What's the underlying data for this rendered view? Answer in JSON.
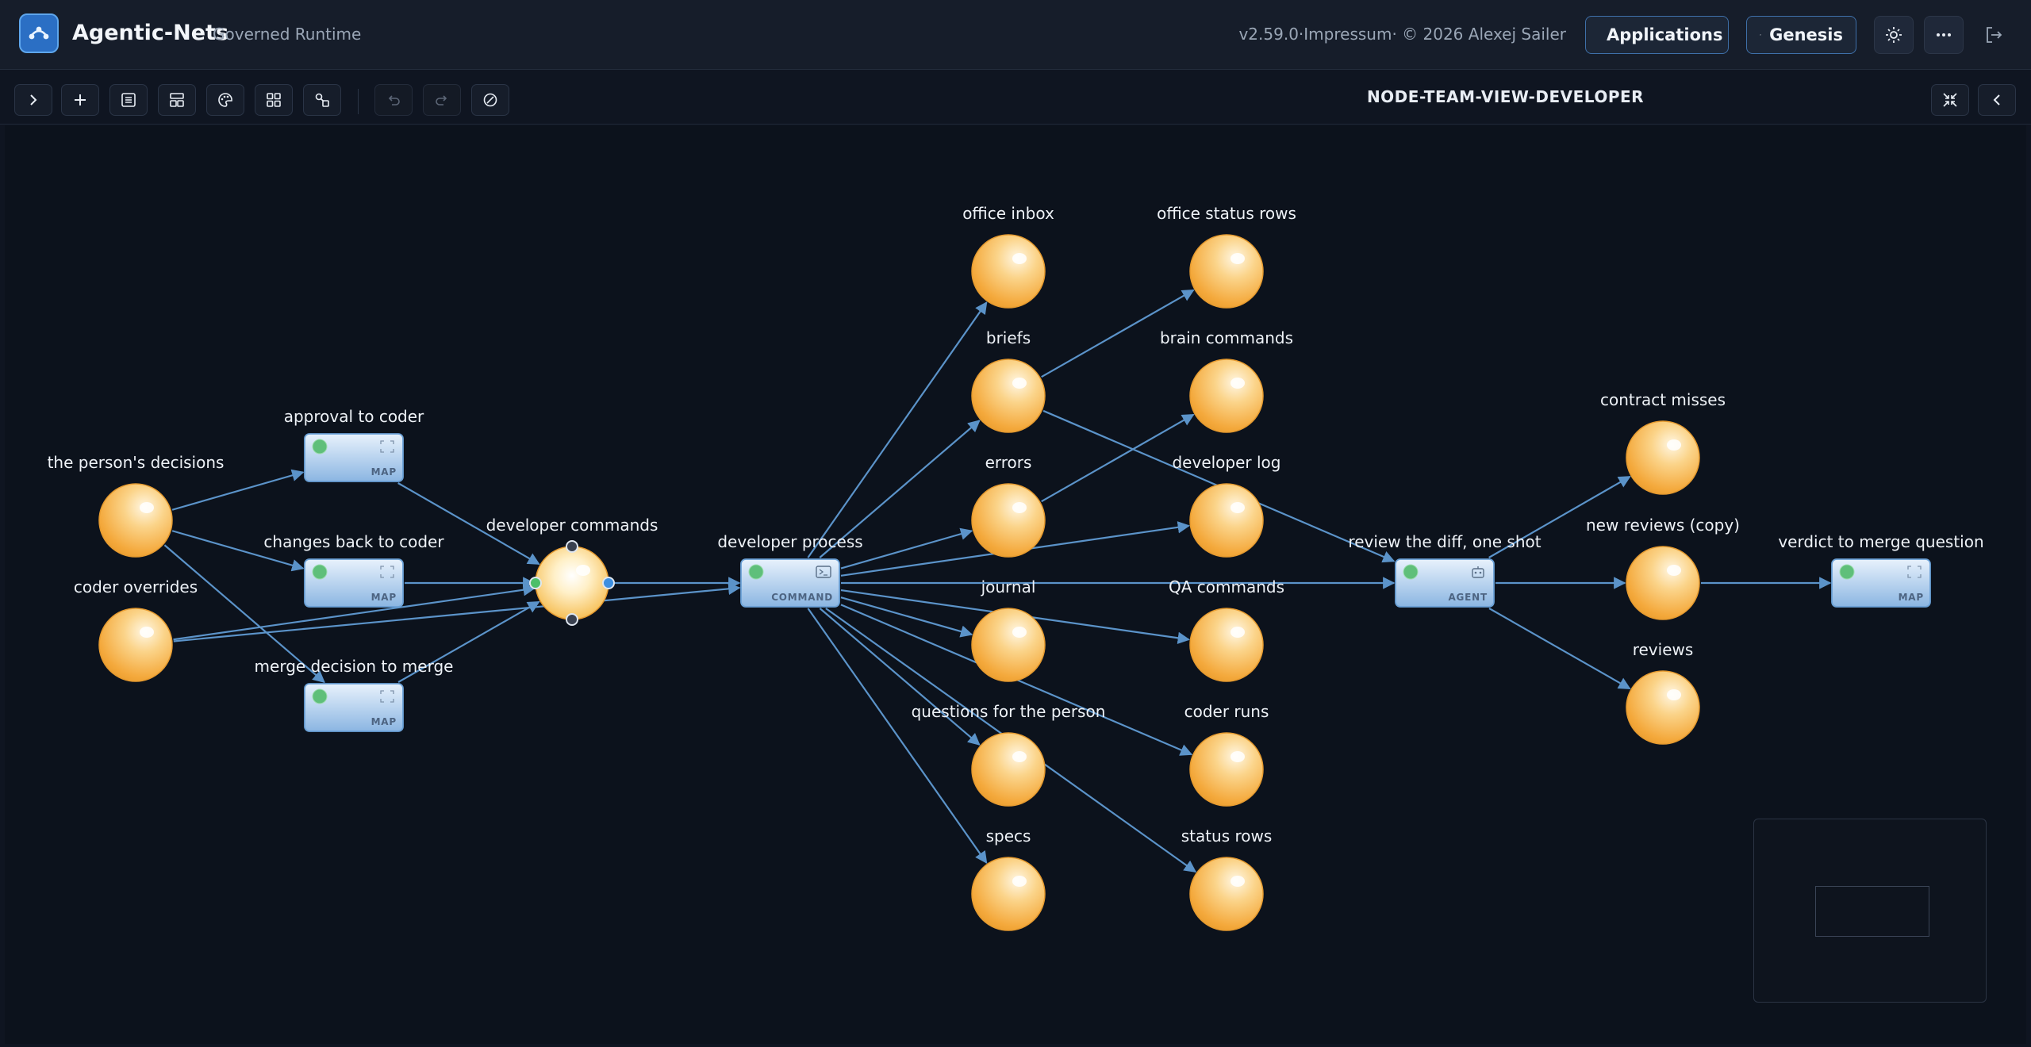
{
  "header": {
    "app_title": "Agentic-Nets",
    "app_subtitle": "Governed Runtime",
    "version": "v2.59.0·Impressum· © 2026 Alexej Sailer",
    "applications_label": "Applications",
    "genesis_label": "Genesis",
    "icons": [
      "network-logo-icon",
      "applications-icon",
      "genesis-sparkle-icon",
      "theme-sun-icon",
      "more-icon",
      "logout-icon"
    ]
  },
  "toolbar": {
    "icons": [
      "expand-chevron-icon",
      "add-icon",
      "list-icon",
      "layout-icon",
      "palette-icon",
      "grid-icon",
      "connect-icon",
      "undo-icon",
      "redo-icon",
      "validate-icon",
      "fullscreen-collapse-icon",
      "panel-collapse-icon"
    ],
    "net_title": "NODE-TEAM-VIEW-DEVELOPER"
  },
  "colors": {
    "accent": "#3e6fa8",
    "arc": "#5b93c9",
    "place": "#f7b84c",
    "transition": "#a6c9ee",
    "enabled": "#5fbf7a"
  },
  "net": {
    "places": [
      {
        "id": "p_decisions",
        "label": "the person's decisions"
      },
      {
        "id": "p_overrides",
        "label": "coder overrides"
      },
      {
        "id": "p_devcmd",
        "label": "developer commands"
      },
      {
        "id": "p_inbox",
        "label": "office inbox"
      },
      {
        "id": "p_briefs",
        "label": "briefs"
      },
      {
        "id": "p_errors",
        "label": "errors"
      },
      {
        "id": "p_journal",
        "label": "journal"
      },
      {
        "id": "p_questions",
        "label": "questions for the person"
      },
      {
        "id": "p_specs",
        "label": "specs"
      },
      {
        "id": "p_status",
        "label": "office status rows"
      },
      {
        "id": "p_brain",
        "label": "brain commands"
      },
      {
        "id": "p_devlog",
        "label": "developer log"
      },
      {
        "id": "p_qa",
        "label": "QA commands"
      },
      {
        "id": "p_coder",
        "label": "coder runs"
      },
      {
        "id": "p_statusrows",
        "label": "status rows"
      },
      {
        "id": "p_misses",
        "label": "contract misses"
      },
      {
        "id": "p_newrev",
        "label": "new reviews (copy)"
      },
      {
        "id": "p_reviews",
        "label": "reviews"
      }
    ],
    "transitions": [
      {
        "id": "t_approval",
        "label": "approval to coder",
        "kind": "MAP"
      },
      {
        "id": "t_changes",
        "label": "changes back to coder",
        "kind": "MAP"
      },
      {
        "id": "t_merge",
        "label": "merge decision to merge",
        "kind": "MAP"
      },
      {
        "id": "t_process",
        "label": "developer process",
        "kind": "COMMAND"
      },
      {
        "id": "t_review",
        "label": "review the diff, one shot",
        "kind": "AGENT"
      },
      {
        "id": "t_verdict",
        "label": "verdict to merge question",
        "kind": "MAP"
      }
    ],
    "arcs": [
      [
        "p_decisions",
        "t_approval"
      ],
      [
        "p_decisions",
        "t_changes"
      ],
      [
        "p_decisions",
        "t_merge"
      ],
      [
        "t_approval",
        "p_devcmd"
      ],
      [
        "t_changes",
        "p_devcmd"
      ],
      [
        "t_merge",
        "p_devcmd"
      ],
      [
        "p_overrides",
        "p_devcmd"
      ],
      [
        "p_devcmd",
        "t_process"
      ],
      [
        "p_overrides",
        "t_process"
      ],
      [
        "t_process",
        "p_inbox"
      ],
      [
        "t_process",
        "p_briefs"
      ],
      [
        "t_process",
        "p_errors"
      ],
      [
        "t_process",
        "p_journal"
      ],
      [
        "t_process",
        "p_questions"
      ],
      [
        "t_process",
        "p_specs"
      ],
      [
        "t_process",
        "p_devlog"
      ],
      [
        "t_process",
        "p_qa"
      ],
      [
        "t_process",
        "p_coder"
      ],
      [
        "t_process",
        "p_statusrows"
      ],
      [
        "t_process",
        "t_review"
      ],
      [
        "p_briefs",
        "p_status"
      ],
      [
        "p_errors",
        "p_brain"
      ],
      [
        "p_briefs",
        "t_review"
      ],
      [
        "t_review",
        "p_misses"
      ],
      [
        "t_review",
        "p_newrev"
      ],
      [
        "t_review",
        "p_reviews"
      ],
      [
        "p_newrev",
        "t_verdict"
      ]
    ]
  }
}
